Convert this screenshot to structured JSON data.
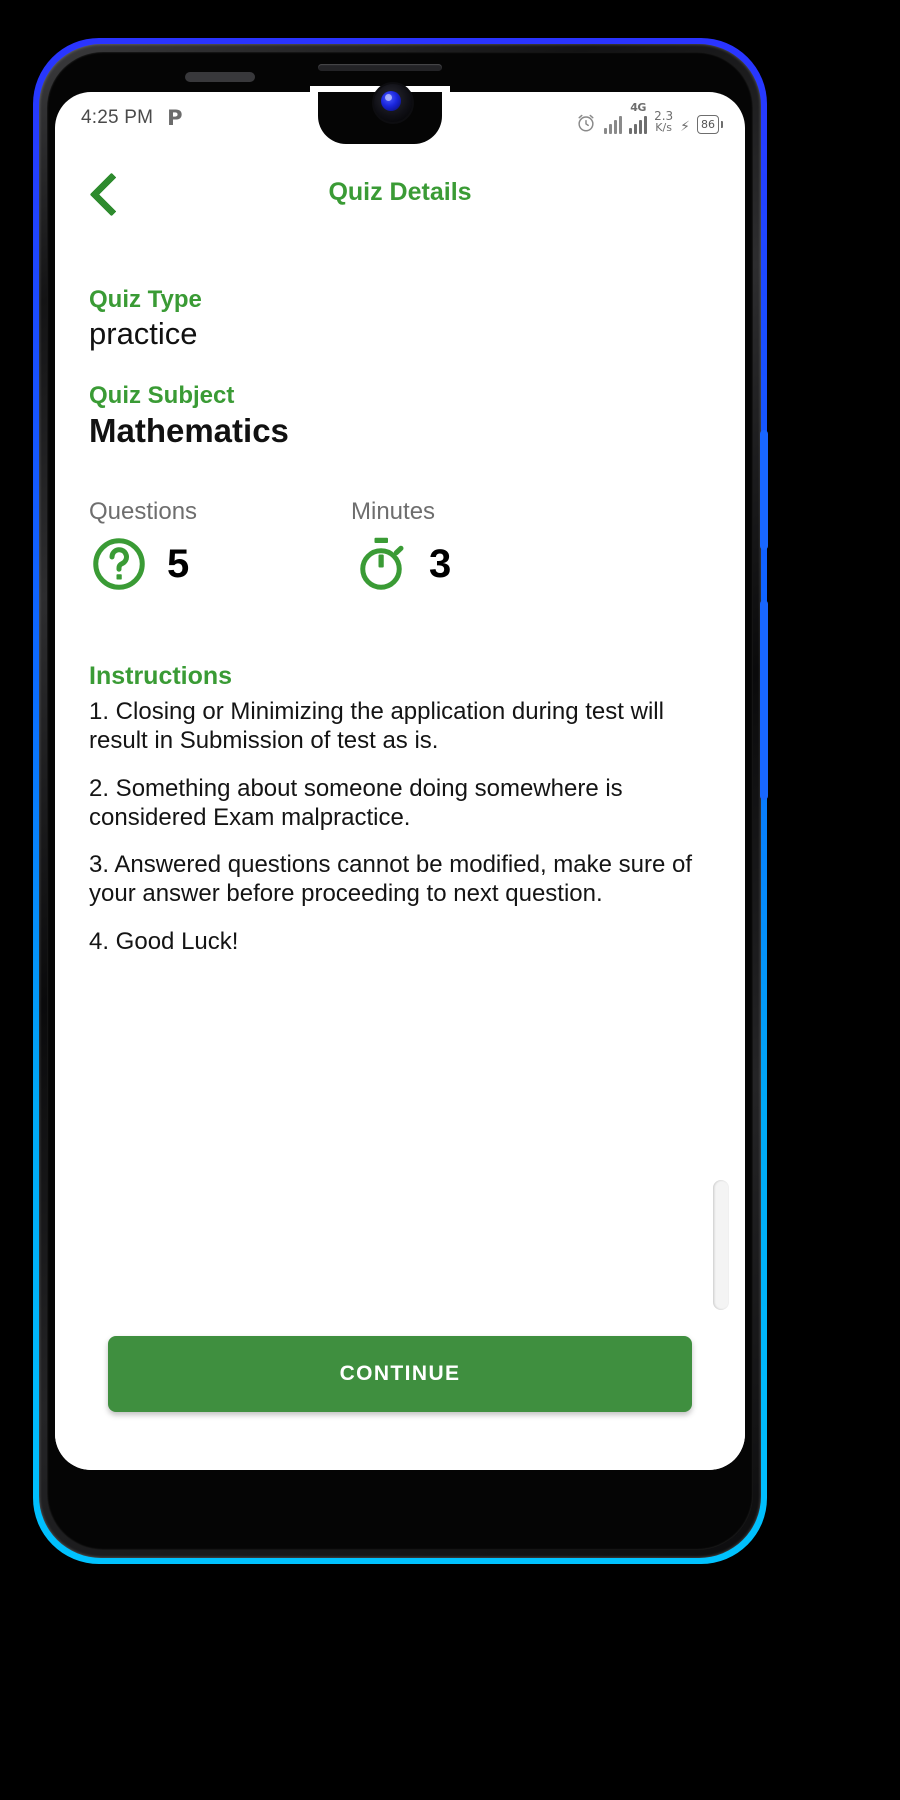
{
  "status_bar": {
    "time": "4:25 PM",
    "app_icon": "P",
    "alarm_icon": "alarm-clock-icon",
    "network_type": "4G",
    "net_speed_value": "2.3",
    "net_speed_unit": "K/s",
    "charging_icon": "⚡",
    "battery_percent": "86"
  },
  "appbar": {
    "back_icon": "chevron-left-icon",
    "title": "Quiz Details"
  },
  "details": {
    "type_label": "Quiz Type",
    "type_value": "practice",
    "subject_label": "Quiz Subject",
    "subject_value": "Mathematics"
  },
  "stats": [
    {
      "label": "Questions",
      "value": "5",
      "icon": "question-circle-icon"
    },
    {
      "label": "Minutes",
      "value": "3",
      "icon": "stopwatch-icon"
    }
  ],
  "instructions": {
    "title": "Instructions",
    "items": [
      "1. Closing or Minimizing the application during test will result in Submission of test as is.",
      "2. Something about someone doing somewhere is considered Exam malpractice.",
      "3. Answered questions cannot be modified, make sure of your answer before proceeding to next question.",
      "4. Good Luck!"
    ]
  },
  "cta": {
    "label": "CONTINUE"
  },
  "colors": {
    "brand_green": "#3a9b35",
    "button_green": "#3f8f3f",
    "muted_gray": "#6e6e6e",
    "bezel_blue": "#1866ff"
  }
}
